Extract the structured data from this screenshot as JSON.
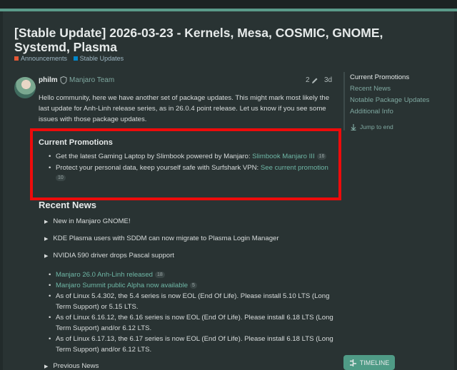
{
  "topic": {
    "title": "[Stable Update] 2026-03-23 - Kernels, Mesa, COSMIC, GNOME, Systemd, Plasma",
    "categories": [
      {
        "label": "Announcements",
        "color": "#e45735"
      },
      {
        "label": "Stable Updates",
        "color": "#0088cc"
      }
    ]
  },
  "post": {
    "author": "philm",
    "author_icon": "shield-icon",
    "team": "Manjaro Team",
    "edit_count": "2",
    "age": "3d",
    "intro": "Hello community, here we have another set of package updates. This might mark most likely the last update for Anh-Linh release series, as in 26.0.4 point release. Let us know if you see some issues with those package updates."
  },
  "promotions": {
    "heading": "Current Promotions",
    "items": [
      {
        "text": "Get the latest Gaming Laptop by Slimbook powered by Manjaro: ",
        "link": "Slimbook Manjaro III",
        "count": "16"
      },
      {
        "text": "Protect your personal data, keep yourself safe with Surfshark VPN: ",
        "link": "See current promotion",
        "count": "10"
      }
    ]
  },
  "news": {
    "heading": "Recent News",
    "toggles": [
      "New in Manjaro GNOME!",
      "KDE Plasma users with SDDM can now migrate to Plasma Login Manager",
      "NVIDIA 590 driver drops Pascal support"
    ],
    "links": [
      {
        "link": "Manjaro 26.0 Anh-Linh released",
        "count": "18"
      },
      {
        "link": "Manjaro Summit public Alpha now available",
        "count": "5"
      }
    ],
    "eol_items": [
      "As of Linux 5.4.302, the 5.4 series is now EOL (End Of Life). Please install 5.10 LTS (Long Term Support) or 5.15 LTS.",
      "As of Linux 6.16.12, the 6.16 series is now EOL (End Of Life). Please install 6.18 LTS (Long Term Support) and/or 6.12 LTS.",
      "As of Linux 6.17.13, the 6.17 series is now EOL (End Of Life). Please install 6.18 LTS (Long Term Support) and/or 6.12 LTS."
    ],
    "previous": "Previous News"
  },
  "toc": {
    "items": [
      "Current Promotions",
      "Recent News",
      "Notable Package Updates",
      "Additional Info"
    ],
    "active_index": 0,
    "jump_label": "Jump to end"
  },
  "timeline_button": "TIMELINE",
  "colors": {
    "accent": "#5a9b8a",
    "link": "#6fb7a6",
    "highlight_box": "#ee0b0b"
  }
}
